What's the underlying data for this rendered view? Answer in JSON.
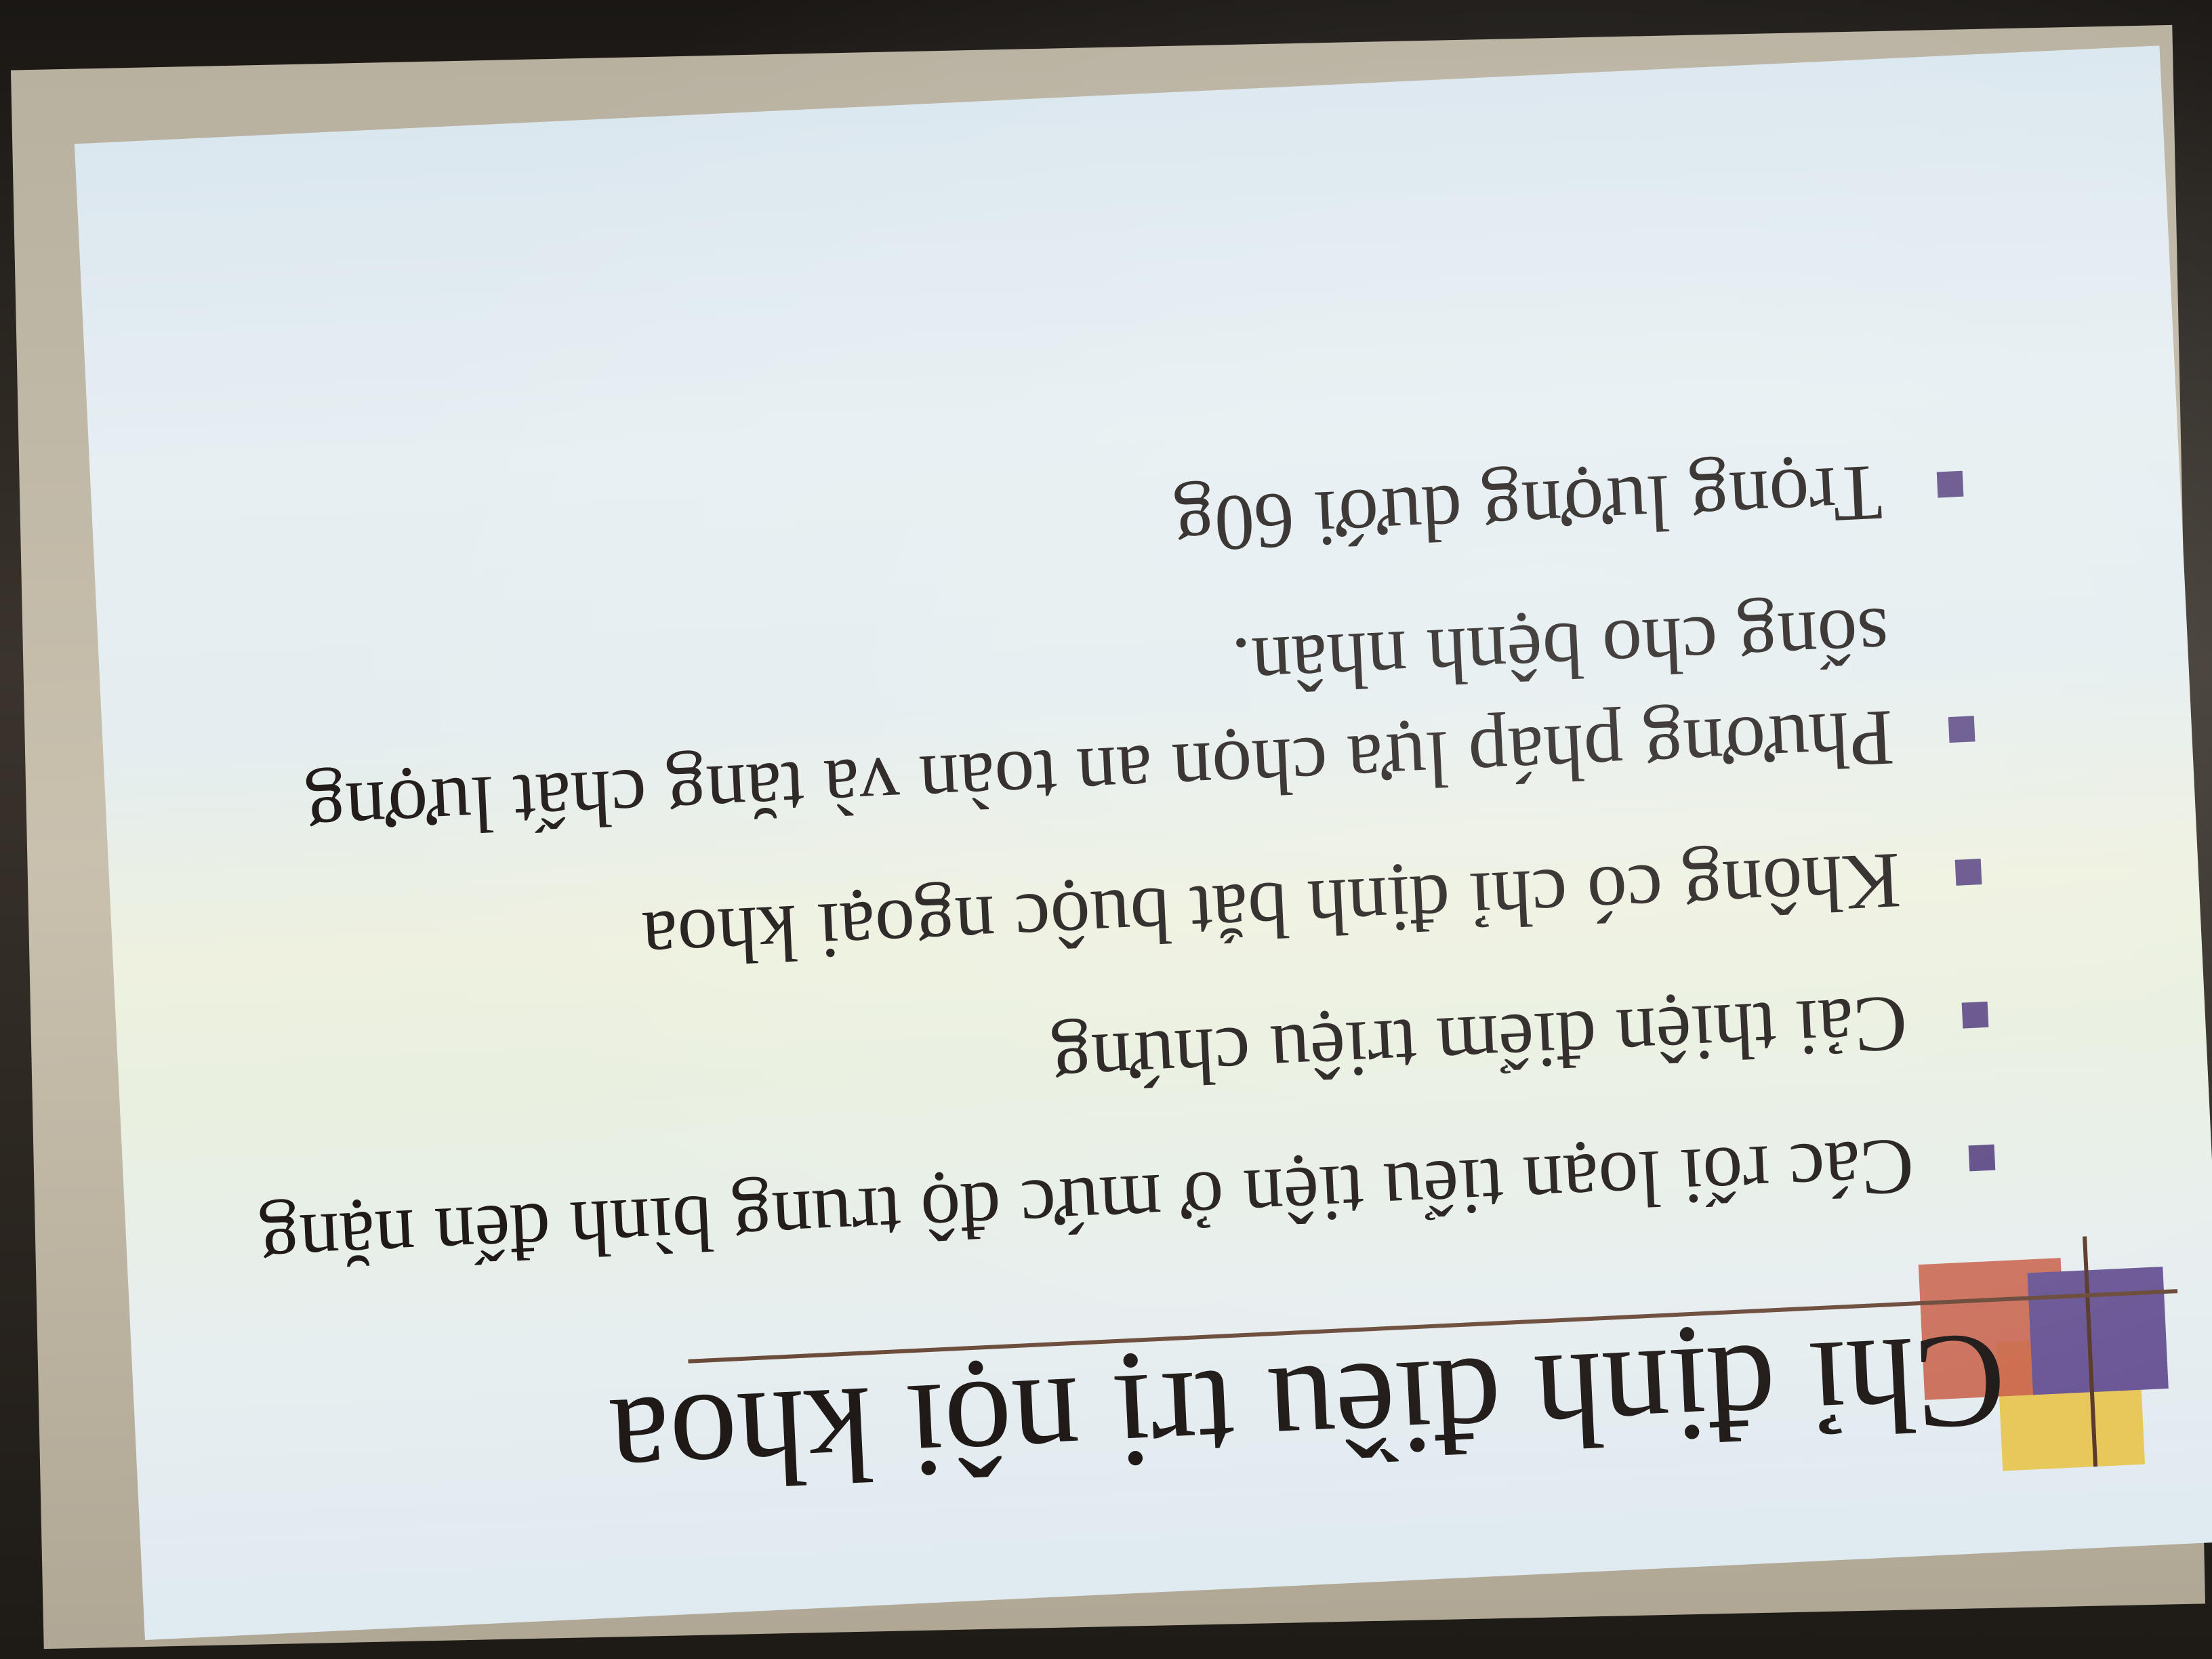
{
  "slide": {
    "title": "Chỉ định điều trị nội khoa",
    "bullets": [
      "Các rối loạn tiểu tiện ở mức độ trung bình đến nặng",
      "Cải thiện điểm triệu chứng",
      "Không có chỉ định bắt buộc ngoại khoa",
      "Phương pháp lựa chọn an toàn và tăng chất lượng sống cho bệnh nhân.",
      "Trọng lượng dưới 60g"
    ]
  },
  "colors": {
    "accent_purple": "#5e4c86",
    "accent_yellow": "#e8c85a",
    "accent_red": "#c9644e",
    "text": "#1f1a18"
  }
}
